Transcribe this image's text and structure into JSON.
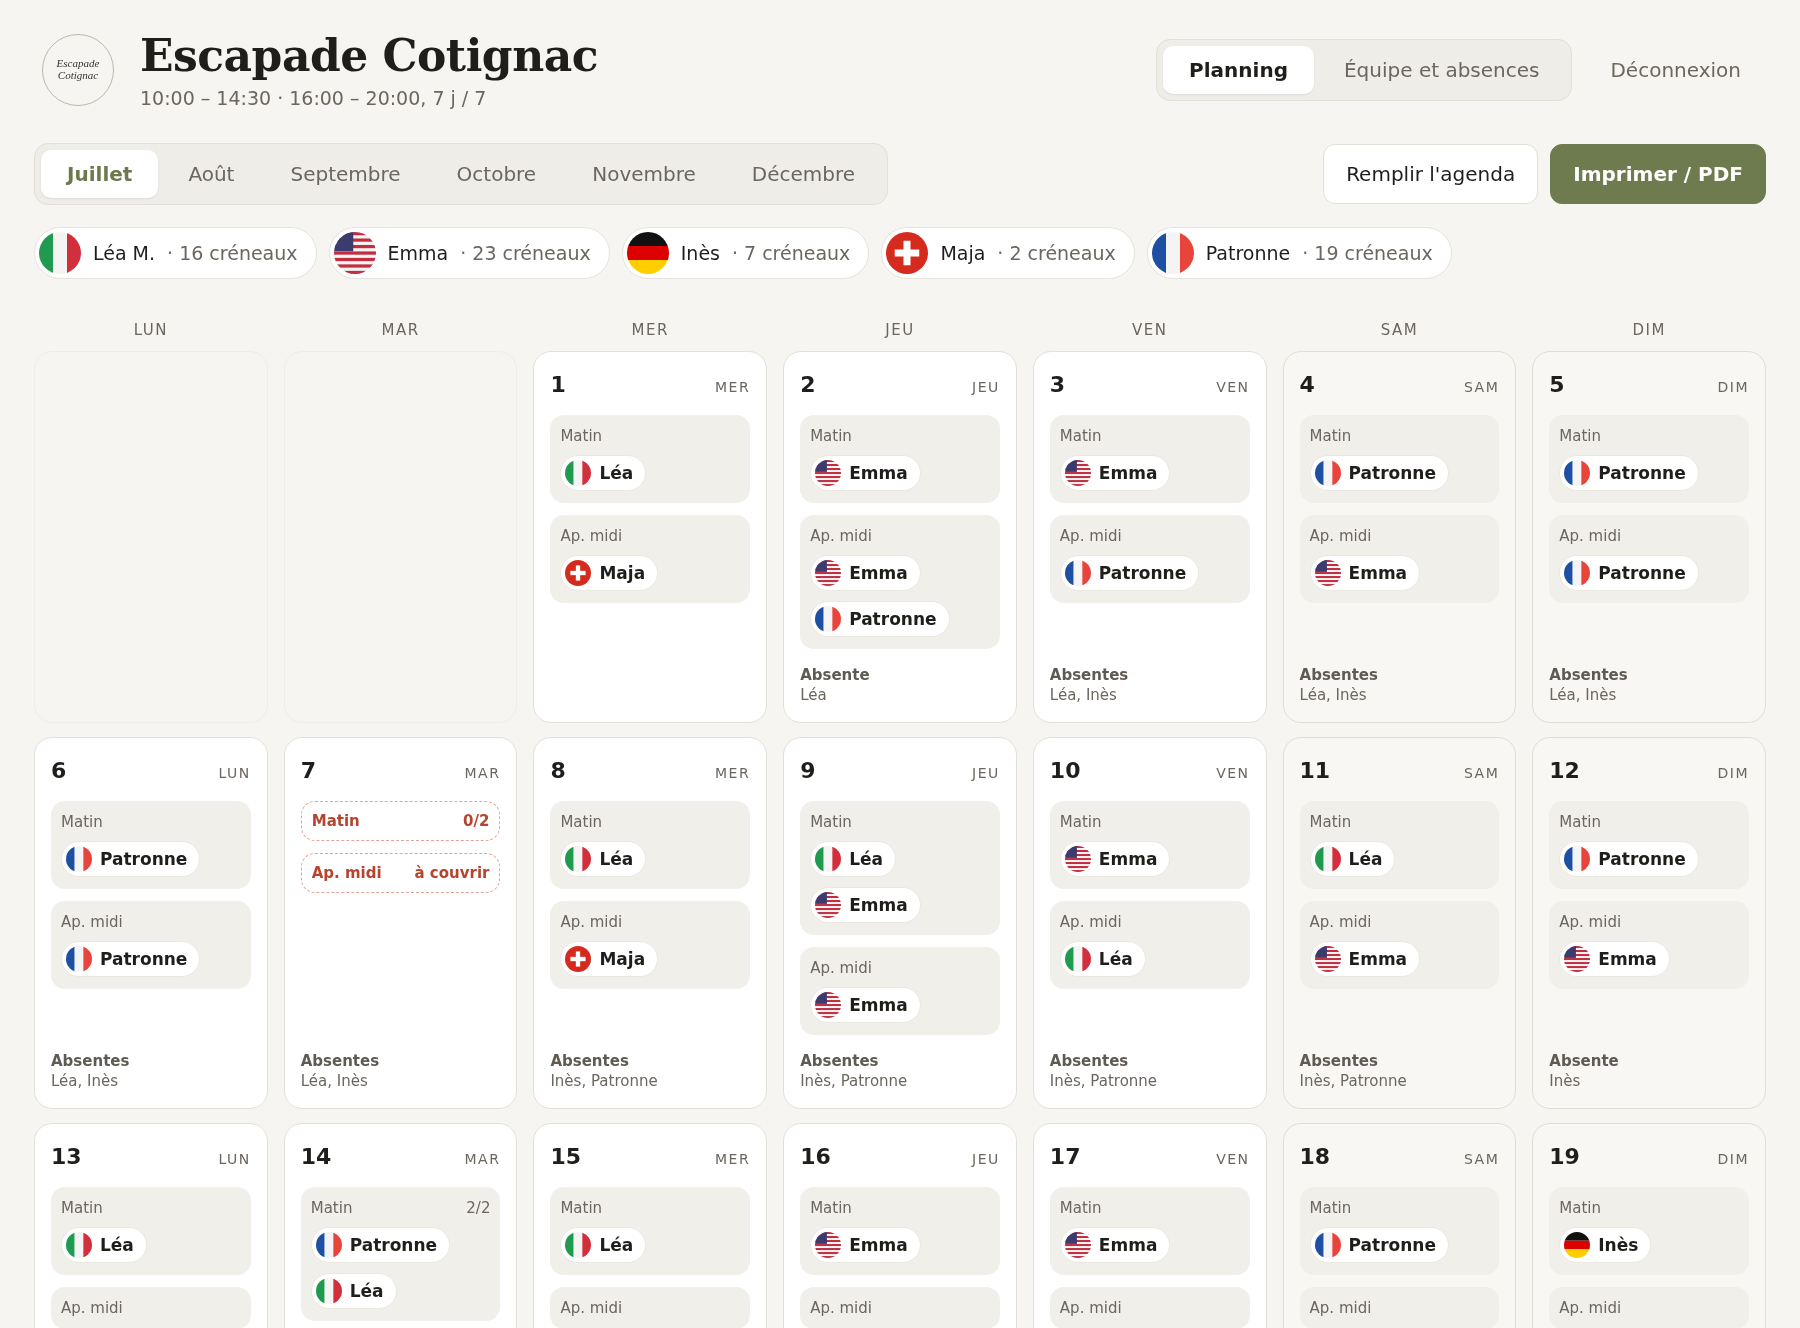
{
  "header": {
    "logo_text": "Escapade Cotignac",
    "title": "Escapade Cotignac",
    "subtitle": "10:00 – 14:30 · 16:00 – 20:00, 7 j / 7"
  },
  "nav": {
    "tabs": [
      {
        "label": "Planning",
        "selected": true
      },
      {
        "label": "Équipe et absences",
        "selected": false
      }
    ],
    "logout": "Déconnexion"
  },
  "months": [
    {
      "label": "Juillet",
      "selected": true
    },
    {
      "label": "Août",
      "selected": false
    },
    {
      "label": "Septembre",
      "selected": false
    },
    {
      "label": "Octobre",
      "selected": false
    },
    {
      "label": "Novembre",
      "selected": false
    },
    {
      "label": "Décembre",
      "selected": false
    }
  ],
  "actions": [
    {
      "label": "Remplir l'agenda",
      "kind": "secondary"
    },
    {
      "label": "Imprimer / PDF",
      "kind": "primary"
    }
  ],
  "team": [
    {
      "name": "Léa M.",
      "kind": "it",
      "count": "· 16 créneaux"
    },
    {
      "name": "Emma",
      "kind": "us",
      "count": "· 23 créneaux"
    },
    {
      "name": "Inès",
      "kind": "de",
      "count": "· 7 créneaux"
    },
    {
      "name": "Maja",
      "kind": "ch",
      "count": "· 2 créneaux"
    },
    {
      "name": "Patronne",
      "kind": "fr",
      "count": "· 19 créneaux"
    }
  ],
  "weekdays": [
    "LUN",
    "MAR",
    "MER",
    "JEU",
    "VEN",
    "SAM",
    "DIM"
  ],
  "days": [
    {
      "kind": "blank"
    },
    {
      "kind": "blank"
    },
    {
      "kind": "day",
      "number": "1",
      "weekday": "MER",
      "weekend": false,
      "shifts": [
        {
          "label": "Matin",
          "uncovered": false,
          "staff": [
            {
              "name": "Léa",
              "kind": "it"
            }
          ]
        },
        {
          "label": "Ap. midi",
          "uncovered": false,
          "staff": [
            {
              "name": "Maja",
              "kind": "ch"
            }
          ]
        }
      ]
    },
    {
      "kind": "day",
      "number": "2",
      "weekday": "JEU",
      "weekend": false,
      "shifts": [
        {
          "label": "Matin",
          "uncovered": false,
          "staff": [
            {
              "name": "Emma",
              "kind": "us"
            }
          ]
        },
        {
          "label": "Ap. midi",
          "uncovered": false,
          "staff": [
            {
              "name": "Emma",
              "kind": "us"
            },
            {
              "name": "Patronne",
              "kind": "fr"
            }
          ]
        }
      ],
      "absent_title": "Absente",
      "absent_names": "Léa"
    },
    {
      "kind": "day",
      "number": "3",
      "weekday": "VEN",
      "weekend": false,
      "shifts": [
        {
          "label": "Matin",
          "uncovered": false,
          "staff": [
            {
              "name": "Emma",
              "kind": "us"
            }
          ]
        },
        {
          "label": "Ap. midi",
          "uncovered": false,
          "staff": [
            {
              "name": "Patronne",
              "kind": "fr"
            }
          ]
        }
      ],
      "absent_title": "Absentes",
      "absent_names": "Léa, Inès"
    },
    {
      "kind": "day",
      "number": "4",
      "weekday": "SAM",
      "weekend": true,
      "shifts": [
        {
          "label": "Matin",
          "uncovered": false,
          "staff": [
            {
              "name": "Patronne",
              "kind": "fr"
            }
          ]
        },
        {
          "label": "Ap. midi",
          "uncovered": false,
          "staff": [
            {
              "name": "Emma",
              "kind": "us"
            }
          ]
        }
      ],
      "absent_title": "Absentes",
      "absent_names": "Léa, Inès"
    },
    {
      "kind": "day",
      "number": "5",
      "weekday": "DIM",
      "weekend": true,
      "shifts": [
        {
          "label": "Matin",
          "uncovered": false,
          "staff": [
            {
              "name": "Patronne",
              "kind": "fr"
            }
          ]
        },
        {
          "label": "Ap. midi",
          "uncovered": false,
          "staff": [
            {
              "name": "Patronne",
              "kind": "fr"
            }
          ]
        }
      ],
      "absent_title": "Absentes",
      "absent_names": "Léa, Inès"
    },
    {
      "kind": "day",
      "number": "6",
      "weekday": "LUN",
      "weekend": false,
      "shifts": [
        {
          "label": "Matin",
          "uncovered": false,
          "staff": [
            {
              "name": "Patronne",
              "kind": "fr"
            }
          ]
        },
        {
          "label": "Ap. midi",
          "uncovered": false,
          "staff": [
            {
              "name": "Patronne",
              "kind": "fr"
            }
          ]
        }
      ],
      "absent_title": "Absentes",
      "absent_names": "Léa, Inès"
    },
    {
      "kind": "day",
      "number": "7",
      "weekday": "MAR",
      "weekend": false,
      "shifts": [
        {
          "label": "Matin",
          "count": "0/2",
          "uncovered": true
        },
        {
          "label": "Ap. midi",
          "count": "à couvrir",
          "uncovered": true
        }
      ],
      "absent_title": "Absentes",
      "absent_names": "Léa, Inès"
    },
    {
      "kind": "day",
      "number": "8",
      "weekday": "MER",
      "weekend": false,
      "shifts": [
        {
          "label": "Matin",
          "uncovered": false,
          "staff": [
            {
              "name": "Léa",
              "kind": "it"
            }
          ]
        },
        {
          "label": "Ap. midi",
          "uncovered": false,
          "staff": [
            {
              "name": "Maja",
              "kind": "ch"
            }
          ]
        }
      ],
      "absent_title": "Absentes",
      "absent_names": "Inès, Patronne"
    },
    {
      "kind": "day",
      "number": "9",
      "weekday": "JEU",
      "weekend": false,
      "shifts": [
        {
          "label": "Matin",
          "uncovered": false,
          "staff": [
            {
              "name": "Léa",
              "kind": "it"
            },
            {
              "name": "Emma",
              "kind": "us"
            }
          ]
        },
        {
          "label": "Ap. midi",
          "uncovered": false,
          "staff": [
            {
              "name": "Emma",
              "kind": "us"
            }
          ]
        }
      ],
      "absent_title": "Absentes",
      "absent_names": "Inès, Patronne"
    },
    {
      "kind": "day",
      "number": "10",
      "weekday": "VEN",
      "weekend": false,
      "shifts": [
        {
          "label": "Matin",
          "uncovered": false,
          "staff": [
            {
              "name": "Emma",
              "kind": "us"
            }
          ]
        },
        {
          "label": "Ap. midi",
          "uncovered": false,
          "staff": [
            {
              "name": "Léa",
              "kind": "it"
            }
          ]
        }
      ],
      "absent_title": "Absentes",
      "absent_names": "Inès, Patronne"
    },
    {
      "kind": "day",
      "number": "11",
      "weekday": "SAM",
      "weekend": true,
      "shifts": [
        {
          "label": "Matin",
          "uncovered": false,
          "staff": [
            {
              "name": "Léa",
              "kind": "it"
            }
          ]
        },
        {
          "label": "Ap. midi",
          "uncovered": false,
          "staff": [
            {
              "name": "Emma",
              "kind": "us"
            }
          ]
        }
      ],
      "absent_title": "Absentes",
      "absent_names": "Inès, Patronne"
    },
    {
      "kind": "day",
      "number": "12",
      "weekday": "DIM",
      "weekend": true,
      "shifts": [
        {
          "label": "Matin",
          "uncovered": false,
          "staff": [
            {
              "name": "Patronne",
              "kind": "fr"
            }
          ]
        },
        {
          "label": "Ap. midi",
          "uncovered": false,
          "staff": [
            {
              "name": "Emma",
              "kind": "us"
            }
          ]
        }
      ],
      "absent_title": "Absente",
      "absent_names": "Inès"
    },
    {
      "kind": "day",
      "number": "13",
      "weekday": "LUN",
      "weekend": false,
      "shifts": [
        {
          "label": "Matin",
          "uncovered": false,
          "staff": [
            {
              "name": "Léa",
              "kind": "it"
            }
          ]
        },
        {
          "label": "Ap. midi",
          "uncovered": false
        }
      ]
    },
    {
      "kind": "day",
      "number": "14",
      "weekday": "MAR",
      "weekend": false,
      "shifts": [
        {
          "label": "Matin",
          "count": "2/2",
          "uncovered": false,
          "staff": [
            {
              "name": "Patronne",
              "kind": "fr"
            },
            {
              "name": "Léa",
              "kind": "it"
            }
          ]
        }
      ]
    },
    {
      "kind": "day",
      "number": "15",
      "weekday": "MER",
      "weekend": false,
      "shifts": [
        {
          "label": "Matin",
          "uncovered": false,
          "staff": [
            {
              "name": "Léa",
              "kind": "it"
            }
          ]
        },
        {
          "label": "Ap. midi",
          "uncovered": false
        }
      ]
    },
    {
      "kind": "day",
      "number": "16",
      "weekday": "JEU",
      "weekend": false,
      "shifts": [
        {
          "label": "Matin",
          "uncovered": false,
          "staff": [
            {
              "name": "Emma",
              "kind": "us"
            }
          ]
        },
        {
          "label": "Ap. midi",
          "uncovered": false
        }
      ]
    },
    {
      "kind": "day",
      "number": "17",
      "weekday": "VEN",
      "weekend": false,
      "shifts": [
        {
          "label": "Matin",
          "uncovered": false,
          "staff": [
            {
              "name": "Emma",
              "kind": "us"
            }
          ]
        },
        {
          "label": "Ap. midi",
          "uncovered": false
        }
      ]
    },
    {
      "kind": "day",
      "number": "18",
      "weekday": "SAM",
      "weekend": true,
      "shifts": [
        {
          "label": "Matin",
          "uncovered": false,
          "staff": [
            {
              "name": "Patronne",
              "kind": "fr"
            }
          ]
        },
        {
          "label": "Ap. midi",
          "uncovered": false
        }
      ]
    },
    {
      "kind": "day",
      "number": "19",
      "weekday": "DIM",
      "weekend": true,
      "shifts": [
        {
          "label": "Matin",
          "uncovered": false,
          "staff": [
            {
              "name": "Inès",
              "kind": "de"
            }
          ]
        },
        {
          "label": "Ap. midi",
          "uncovered": false
        }
      ]
    }
  ]
}
